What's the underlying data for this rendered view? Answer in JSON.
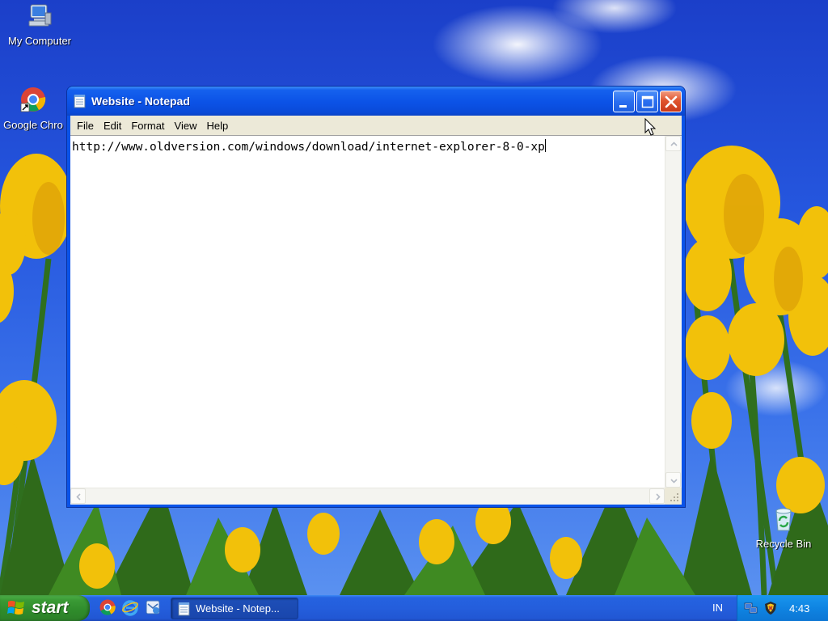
{
  "desktop": {
    "icons": [
      {
        "label": "My Computer",
        "icon": "my-computer-icon"
      },
      {
        "label": "Google Chro",
        "icon": "chrome-icon"
      },
      {
        "label": "Recycle Bin",
        "icon": "recycle-bin-icon"
      }
    ]
  },
  "window": {
    "title": "Website - Notepad",
    "menu": [
      "File",
      "Edit",
      "Format",
      "View",
      "Help"
    ],
    "content": "http://www.oldversion.com/windows/download/internet-explorer-8-0-xp"
  },
  "taskbar": {
    "start_label": "start",
    "quick_launch": [
      "chrome-icon",
      "internet-explorer-icon",
      "outlook-express-icon"
    ],
    "active_task": "Website - Notep...",
    "language": "IN",
    "clock": "4:43"
  },
  "colors": {
    "title_blue": "#0a52e6",
    "start_green": "#3a9a35",
    "close_red": "#e0542e",
    "tray_blue": "#0f84e2"
  }
}
